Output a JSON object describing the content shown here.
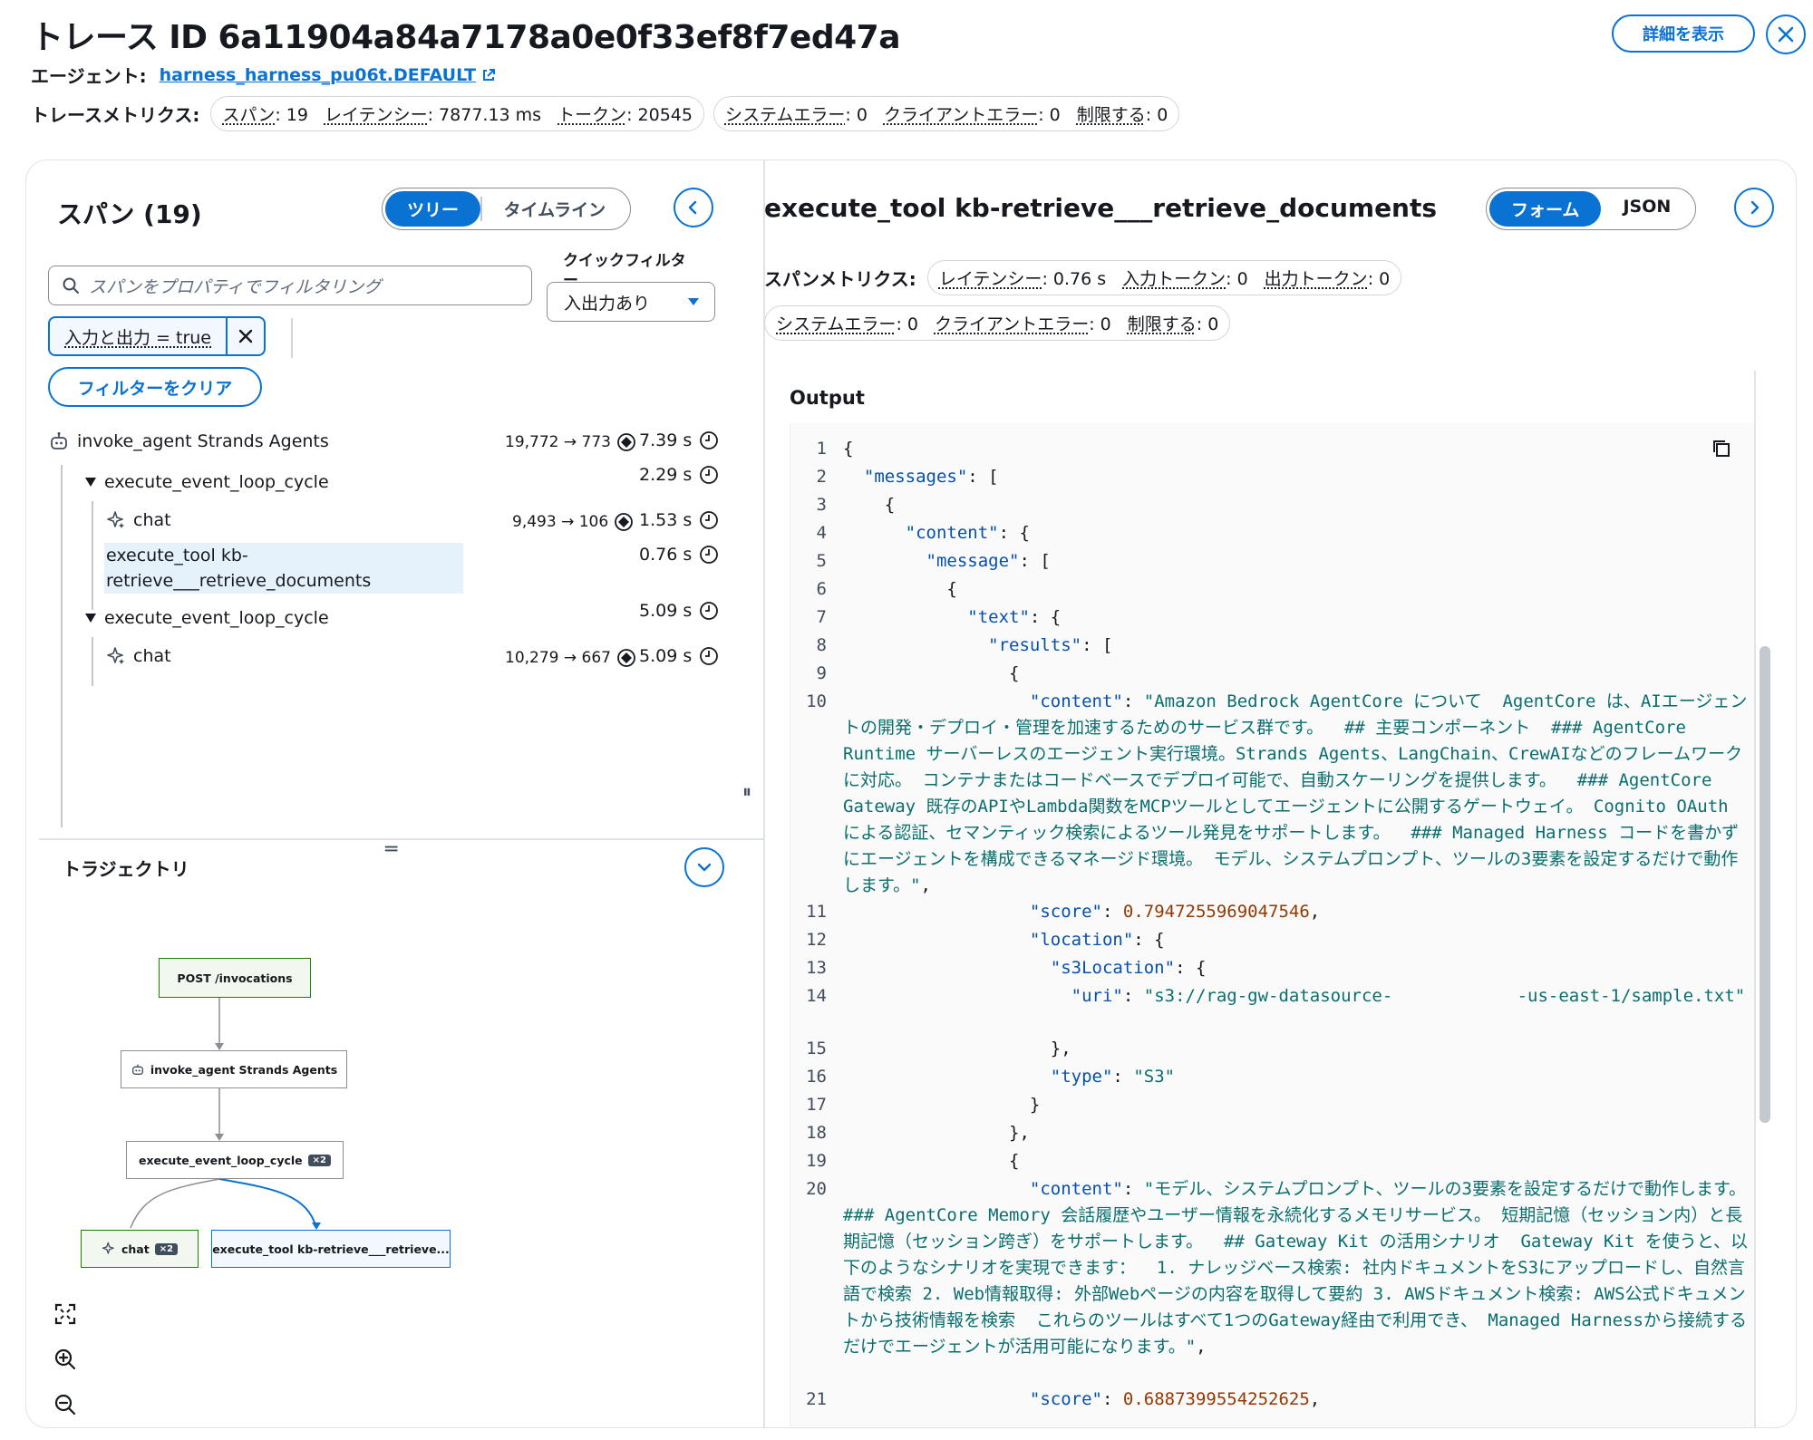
{
  "header": {
    "title": "トレース ID 6a11904a84a7178a0e0f33ef8f7ed47a",
    "agent_label": "エージェント:",
    "agent_link": "harness_harness_pu06t.DEFAULT",
    "metrics_label": "トレースメトリクス:",
    "pill1": [
      {
        "k": "スパン",
        "v": ": 19"
      },
      {
        "k": "レイテンシー",
        "v": ": 7877.13 ms"
      },
      {
        "k": "トークン",
        "v": ": 20545"
      }
    ],
    "pill2": [
      {
        "k": "システムエラー",
        "v": ": 0"
      },
      {
        "k": "クライアントエラー",
        "v": ": 0"
      },
      {
        "k": "制限する",
        "v": ": 0"
      }
    ],
    "detail_button": "詳細を表示"
  },
  "left": {
    "title": "スパン (19)",
    "view_tabs": [
      "ツリー",
      "タイムライン"
    ],
    "search_placeholder": "スパンをプロパティでフィルタリング",
    "quick_filter_label": "クイックフィルター",
    "quick_filter_value": "入出力あり",
    "token_text": "入力と出力 = true",
    "clear_filter": "フィルターをクリア",
    "tree": [
      {
        "label": "invoke_agent Strands Agents",
        "tokens": "19,772 → 773",
        "duration": "7.39 s"
      },
      {
        "label": "execute_event_loop_cycle",
        "tokens": "",
        "duration": "2.29 s"
      },
      {
        "label": "chat",
        "tokens": "9,493 → 106",
        "duration": "1.53 s"
      },
      {
        "label": "execute_tool kb-",
        "label2": "retrieve___retrieve_documents",
        "tokens": "",
        "duration": "0.76 s"
      },
      {
        "label": "execute_event_loop_cycle",
        "tokens": "",
        "duration": "5.09 s"
      },
      {
        "label": "chat",
        "tokens": "10,279 → 667",
        "duration": "5.09 s"
      }
    ],
    "trajectory_title": "トラジェクトリ",
    "graph": {
      "n1": "POST /invocations",
      "n2": "invoke_agent Strands Agents",
      "n3": "execute_event_loop_cycle",
      "n3_badge": "×2",
      "n4": "chat",
      "n4_badge": "×2",
      "n5": "execute_tool kb-retrieve___retrieve..."
    }
  },
  "right": {
    "title": "execute_tool kb-retrieve___retrieve_documents",
    "view_tabs": [
      "フォーム",
      "JSON"
    ],
    "metrics_label": "スパンメトリクス:",
    "pill1": [
      {
        "k": "レイテンシー",
        "v": ": 0.76 s"
      },
      {
        "k": "入力トークン",
        "v": ": 0"
      },
      {
        "k": "出力トークン",
        "v": ": 0"
      }
    ],
    "pill2": [
      {
        "k": "システムエラー",
        "v": ": 0"
      },
      {
        "k": "クライアントエラー",
        "v": ": 0"
      },
      {
        "k": "制限する",
        "v": ": 0"
      }
    ],
    "output_label": "Output",
    "code": [
      {
        "n": "1",
        "t": "{"
      },
      {
        "n": "2",
        "t": "  \"messages\": ["
      },
      {
        "n": "3",
        "t": "    {"
      },
      {
        "n": "4",
        "t": "      \"content\": {"
      },
      {
        "n": "5",
        "t": "        \"message\": ["
      },
      {
        "n": "6",
        "t": "          {"
      },
      {
        "n": "7",
        "t": "            \"text\": {"
      },
      {
        "n": "8",
        "t": "              \"results\": ["
      },
      {
        "n": "9",
        "t": "                {"
      },
      {
        "n": "10",
        "t": "                  \"content\": \"Amazon Bedrock AgentCore について  AgentCore は、AIエージェントの開発・デプロイ・管理を加速するためのサービス群です。  ## 主要コンポーネント  ### AgentCore Runtime サーバーレスのエージェント実行環境。Strands Agents、LangChain、CrewAIなどのフレームワークに対応。 コンテナまたはコードベースでデプロイ可能で、自動スケーリングを提供します。  ### AgentCore Gateway 既存のAPIやLambda関数をMCPツールとしてエージェントに公開するゲートウェイ。 Cognito OAuth による認証、セマンティック検索によるツール発見をサポートします。  ### Managed Harness コードを書かずにエージェントを構成できるマネージド環境。 モデル、システムプロンプト、ツールの3要素を設定するだけで動作します。\","
      },
      {
        "n": "11",
        "t": "                  \"score\": 0.7947255969047546,"
      },
      {
        "n": "12",
        "t": "                  \"location\": {"
      },
      {
        "n": "13",
        "t": "                    \"s3Location\": {"
      },
      {
        "n": "14",
        "t": "                      \"uri\": \"s3://rag-gw-datasource-            -us-east-1/sample.txt\""
      },
      {
        "n": "15",
        "t": "                    },"
      },
      {
        "n": "16",
        "t": "                    \"type\": \"S3\""
      },
      {
        "n": "17",
        "t": "                  }"
      },
      {
        "n": "18",
        "t": "                },"
      },
      {
        "n": "19",
        "t": "                {"
      },
      {
        "n": "20",
        "t": "                  \"content\": \"モデル、システムプロンプト、ツールの3要素を設定するだけで動作します。  ### AgentCore Memory 会話履歴やユーザー情報を永続化するメモリサービス。 短期記憶（セッション内）と長期記憶（セッション跨ぎ）をサポートします。  ## Gateway Kit の活用シナリオ  Gateway Kit を使うと、以下のようなシナリオを実現できます：  1. ナレッジベース検索: 社内ドキュメントをS3にアップロードし、自然言語で検索 2. Web情報取得: 外部Webページの内容を取得して要約 3. AWSドキュメント検索: AWS公式ドキュメントから技術情報を検索  これらのツールはすべて1つのGateway経由で利用でき、 Managed Harnessから接続するだけでエージェントが活用可能になります。\","
      },
      {
        "n": "21",
        "t": "                  \"score\": 0.6887399554252625,"
      }
    ]
  }
}
